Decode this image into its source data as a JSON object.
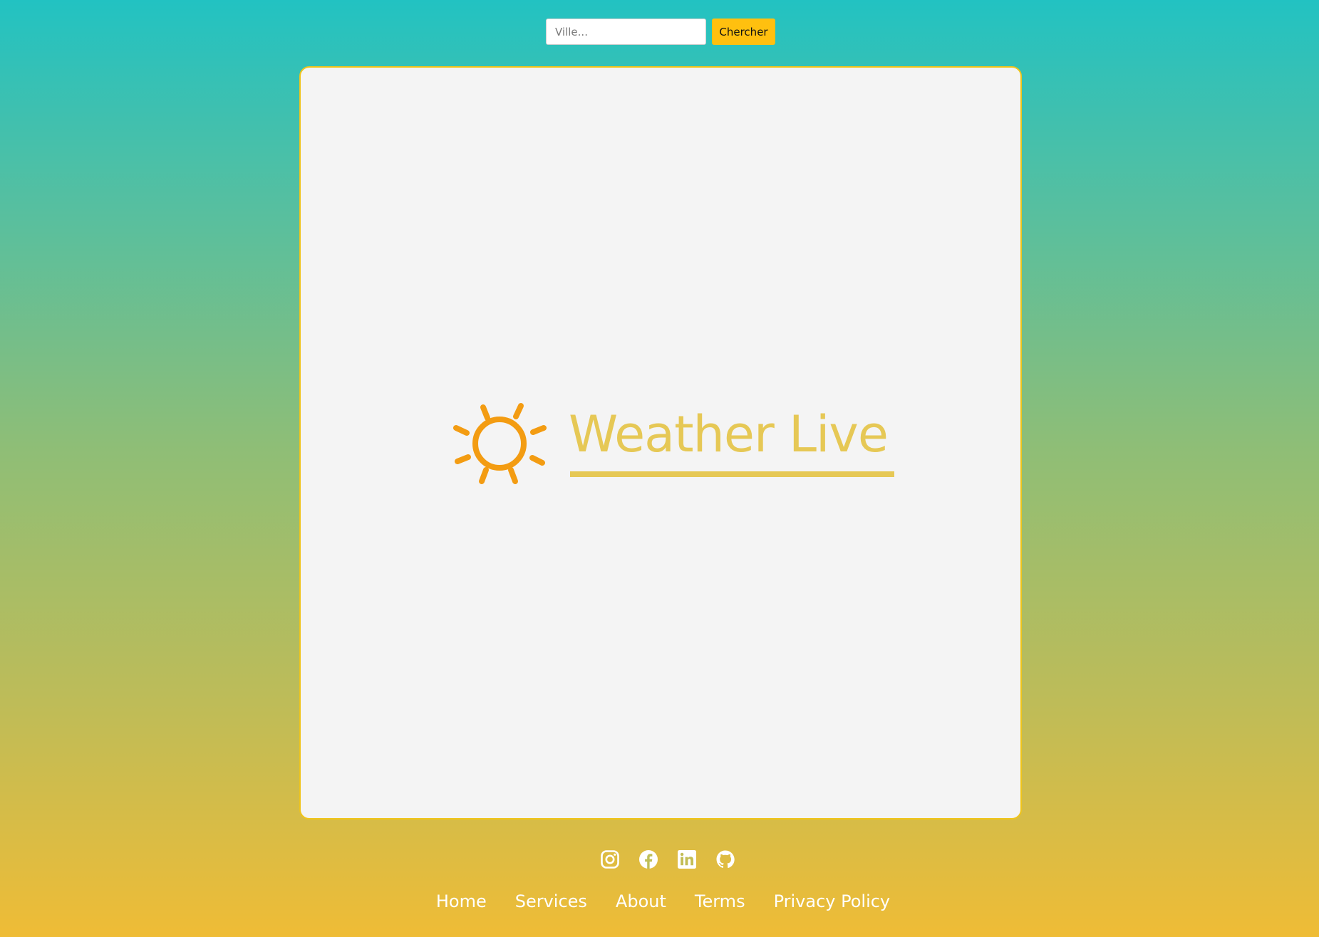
{
  "search": {
    "placeholder": "Ville...",
    "value": "",
    "button_label": "Chercher"
  },
  "brand": {
    "title": "Weather Live",
    "icon": "sun-icon"
  },
  "social": [
    {
      "name": "instagram-icon"
    },
    {
      "name": "facebook-icon"
    },
    {
      "name": "linkedin-icon"
    },
    {
      "name": "github-icon"
    }
  ],
  "footer": {
    "links": [
      "Home",
      "Services",
      "About",
      "Terms",
      "Privacy Policy"
    ]
  },
  "colors": {
    "gradient_top": "#22c2c2",
    "gradient_bottom": "#efbc36",
    "button": "#ffc00f",
    "card_border": "#f0c419",
    "brand_text": "#e6c855",
    "sun": "#f39c12"
  }
}
